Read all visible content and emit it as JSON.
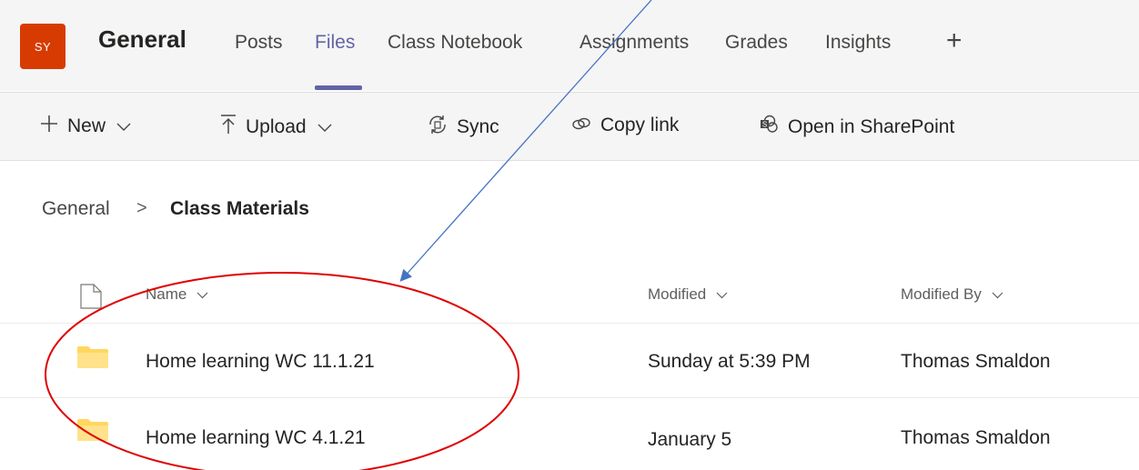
{
  "header": {
    "avatar_initials": "SY",
    "team_name": "General",
    "tabs": [
      {
        "label": "Posts",
        "active": false
      },
      {
        "label": "Files",
        "active": true
      },
      {
        "label": "Class Notebook",
        "active": false
      },
      {
        "label": "Assignments",
        "active": false
      },
      {
        "label": "Grades",
        "active": false
      },
      {
        "label": "Insights",
        "active": false
      }
    ],
    "add_tab_glyph": "+"
  },
  "toolbar": {
    "new_label": "New",
    "upload_label": "Upload",
    "sync_label": "Sync",
    "copy_link_label": "Copy link",
    "open_sharepoint_label": "Open in SharePoint"
  },
  "breadcrumb": {
    "root": "General",
    "separator": ">",
    "current": "Class Materials"
  },
  "table": {
    "columns": {
      "name": "Name",
      "modified": "Modified",
      "modified_by": "Modified By"
    },
    "rows": [
      {
        "name": "Home learning WC 11.1.21",
        "modified": "Sunday at 5:39 PM",
        "modified_by": "Thomas Smaldon",
        "icon": "folder-icon"
      },
      {
        "name": "Home learning WC 4.1.21",
        "modified": "January 5",
        "modified_by": "Thomas Smaldon",
        "icon": "folder-icon"
      }
    ]
  },
  "colors": {
    "accent": "#6264a7",
    "avatar_bg": "#d83b01",
    "folder": "#ffd75e",
    "annotation_arrow": "#4472c4",
    "annotation_circle": "#e00000"
  }
}
